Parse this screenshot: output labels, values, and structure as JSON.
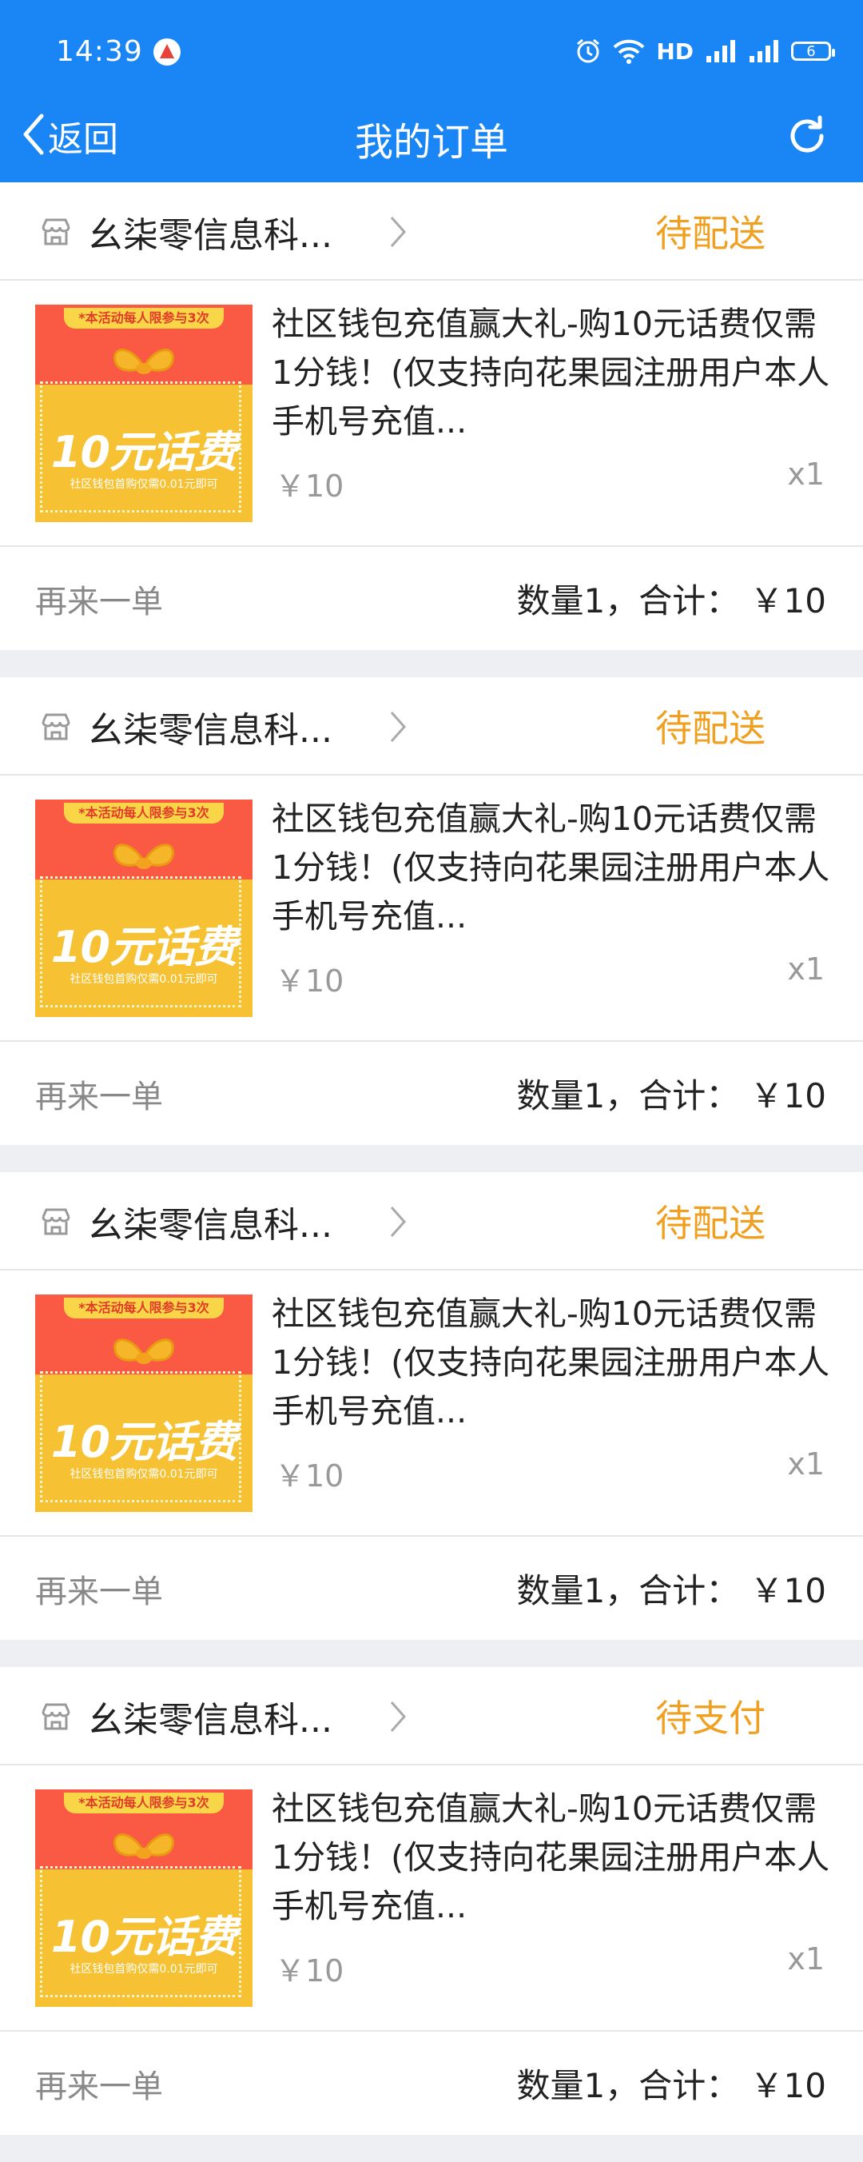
{
  "status_bar": {
    "time": "14:39",
    "network_label": "HD",
    "battery_level": "6"
  },
  "nav": {
    "back_label": "返回",
    "title": "我的订单"
  },
  "orders": [
    {
      "shop_name": "幺柒零信息科...",
      "status": "待配送",
      "product": {
        "image_limit_text": "*本活动每人限参与3次",
        "image_main_text": "10元话费",
        "image_sub_text": "社区钱包首购仅需0.01元即可",
        "title": "社区钱包充值赢大礼-购10元话费仅需1分钱！(仅支持向花果园注册用户本人手机号充值...",
        "price": "￥10",
        "quantity": "x1"
      },
      "reorder_label": "再来一单",
      "summary": "数量1，合计： ￥10"
    },
    {
      "shop_name": "幺柒零信息科...",
      "status": "待配送",
      "product": {
        "image_limit_text": "*本活动每人限参与3次",
        "image_main_text": "10元话费",
        "image_sub_text": "社区钱包首购仅需0.01元即可",
        "title": "社区钱包充值赢大礼-购10元话费仅需1分钱！(仅支持向花果园注册用户本人手机号充值...",
        "price": "￥10",
        "quantity": "x1"
      },
      "reorder_label": "再来一单",
      "summary": "数量1，合计： ￥10"
    },
    {
      "shop_name": "幺柒零信息科...",
      "status": "待配送",
      "product": {
        "image_limit_text": "*本活动每人限参与3次",
        "image_main_text": "10元话费",
        "image_sub_text": "社区钱包首购仅需0.01元即可",
        "title": "社区钱包充值赢大礼-购10元话费仅需1分钱！(仅支持向花果园注册用户本人手机号充值...",
        "price": "￥10",
        "quantity": "x1"
      },
      "reorder_label": "再来一单",
      "summary": "数量1，合计： ￥10"
    },
    {
      "shop_name": "幺柒零信息科...",
      "status": "待支付",
      "product": {
        "image_limit_text": "*本活动每人限参与3次",
        "image_main_text": "10元话费",
        "image_sub_text": "社区钱包首购仅需0.01元即可",
        "title": "社区钱包充值赢大礼-购10元话费仅需1分钱！(仅支持向花果园注册用户本人手机号充值...",
        "price": "￥10",
        "quantity": "x1"
      },
      "reorder_label": "再来一单",
      "summary": "数量1，合计： ￥10"
    }
  ],
  "colors": {
    "primary": "#1a86f5",
    "status_pending": "#f0a020",
    "muted_text": "#999999",
    "page_background": "#eeeff3"
  },
  "icons": [
    "status-app-icon",
    "alarm-icon",
    "wifi-icon",
    "signal-icon",
    "battery-icon",
    "back-arrow-icon",
    "refresh-icon",
    "shop-icon",
    "chevron-right-icon"
  ]
}
